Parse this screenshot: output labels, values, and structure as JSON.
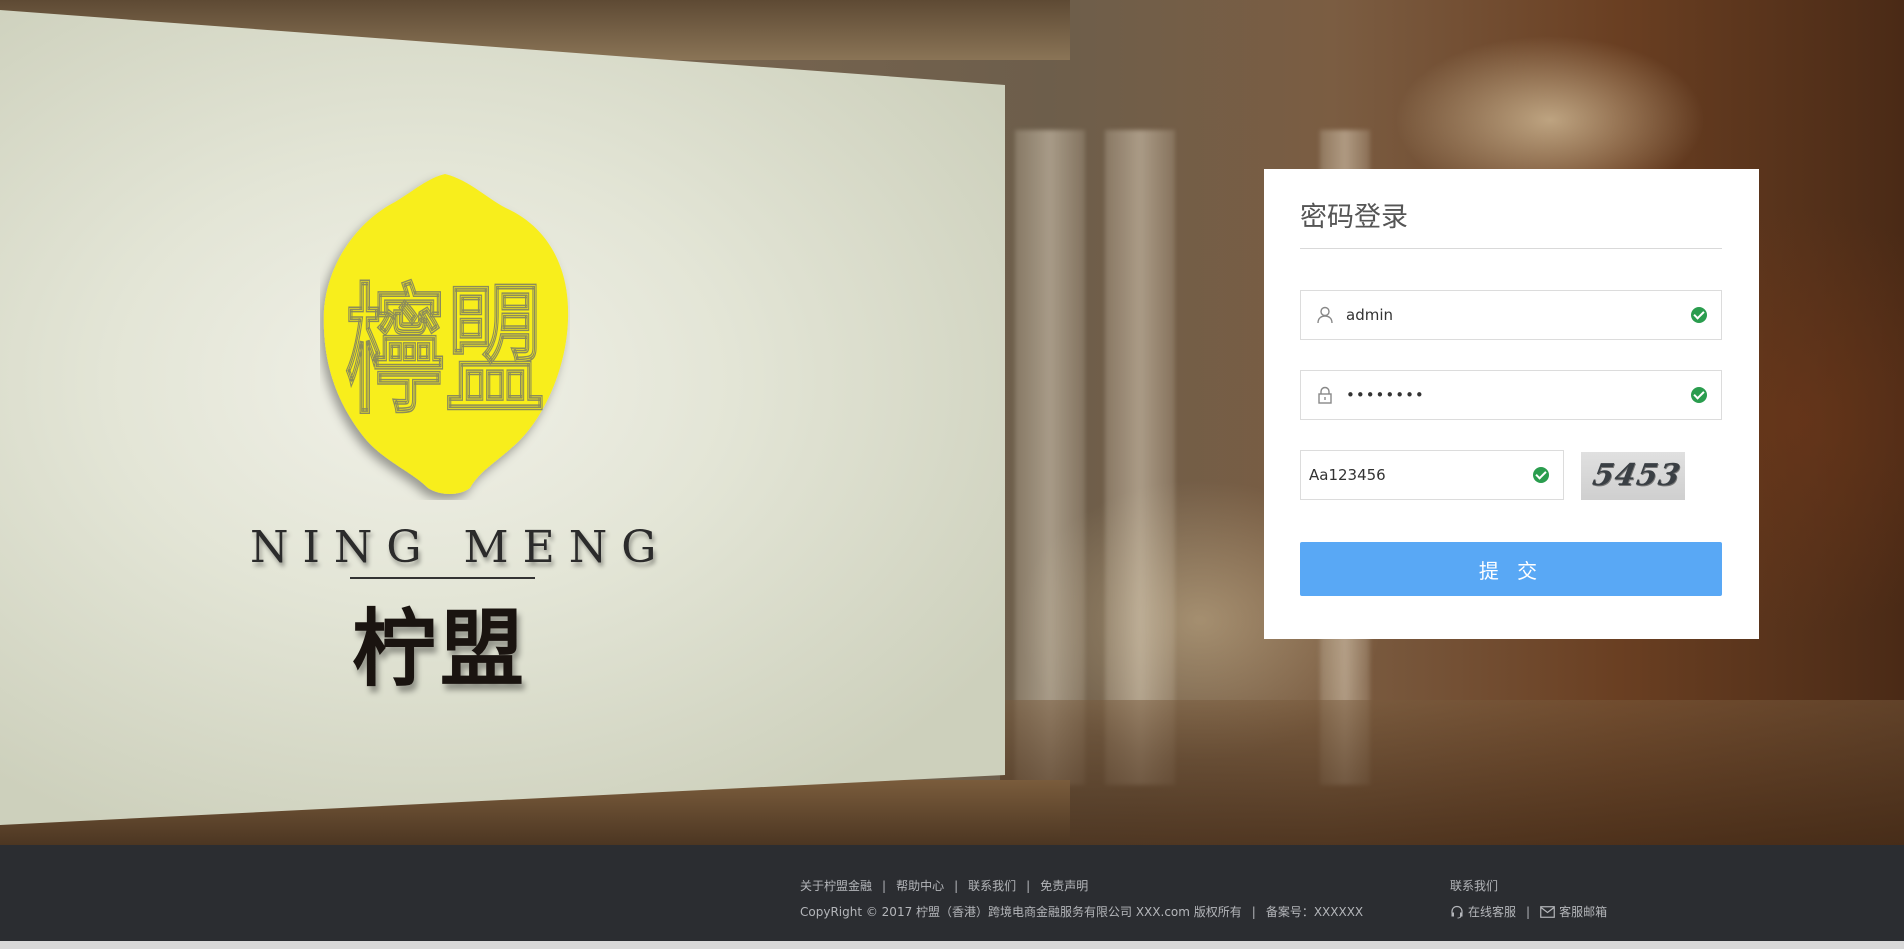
{
  "brand": {
    "logo_char": "檸盟",
    "english_name": "NING MENG",
    "chinese_name": "柠盟"
  },
  "login": {
    "title": "密码登录",
    "username": {
      "value": "admin",
      "icon": "user-icon",
      "valid": true
    },
    "password": {
      "value": "••••••••",
      "icon": "lock-icon",
      "valid": true
    },
    "captcha_input": {
      "value": "Aa123456",
      "valid": true
    },
    "captcha_image_text": "5453",
    "submit_label": "提 交",
    "submit_color": "#59a8f5"
  },
  "footer": {
    "links": [
      "关于柠盟金融",
      "帮助中心",
      "联系我们",
      "免责声明"
    ],
    "link_separator": "|",
    "copyright": "CopyRight © 2017 柠盟（香港）跨境电商金融服务有限公司 XXX.com 版权所有",
    "record": "备案号：XXXXXX",
    "contact_title": "联系我们",
    "contact_items": [
      {
        "label": "在线客服",
        "icon": "headset-icon"
      },
      {
        "label": "客服邮箱",
        "icon": "mail-icon"
      }
    ]
  }
}
